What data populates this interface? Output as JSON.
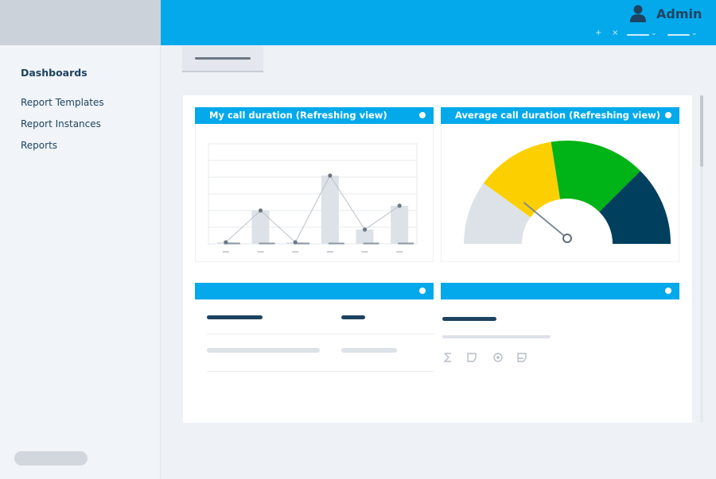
{
  "sidebar": {
    "title": "Dashboards",
    "items": [
      {
        "label": "Report Templates"
      },
      {
        "label": "Report Instances"
      },
      {
        "label": "Reports"
      }
    ]
  },
  "header": {
    "user_name": "Admin",
    "user_icon": "user-icon",
    "controls": [
      "+",
      "×"
    ]
  },
  "widgets": {
    "call_duration": {
      "title": "My call duration (Refreshing view)",
      "chart_data": {
        "type": "bar",
        "categories": [
          "",
          "",
          "",
          "",
          "",
          ""
        ],
        "series": [
          {
            "type": "bar",
            "values": [
              1,
              21,
              1,
              43,
              9,
              24
            ]
          },
          {
            "type": "line",
            "values": [
              1,
              21,
              1,
              43,
              9,
              24
            ]
          }
        ],
        "ylim": [
          0,
          63
        ],
        "grid": true
      }
    },
    "avg_call_duration": {
      "title": "Average call duration (Refreshing view)",
      "gauge": {
        "min": 0,
        "max": 100,
        "value": 23,
        "bands": [
          {
            "from": 0,
            "to": 20,
            "color": "#dde2e8"
          },
          {
            "from": 20,
            "to": 45,
            "color": "#fcd000"
          },
          {
            "from": 45,
            "to": 75,
            "color": "#00b316"
          },
          {
            "from": 75,
            "to": 100,
            "color": "#003f5e"
          }
        ]
      }
    },
    "bottom_left": {
      "title": ""
    },
    "bottom_right": {
      "title": "",
      "icons": [
        "sigma-icon",
        "flag-icon",
        "target-icon",
        "flag-outline-icon"
      ]
    }
  },
  "colors": {
    "accent": "#03a9eb",
    "navy": "#1d4360",
    "bar": "#dde2e8"
  }
}
